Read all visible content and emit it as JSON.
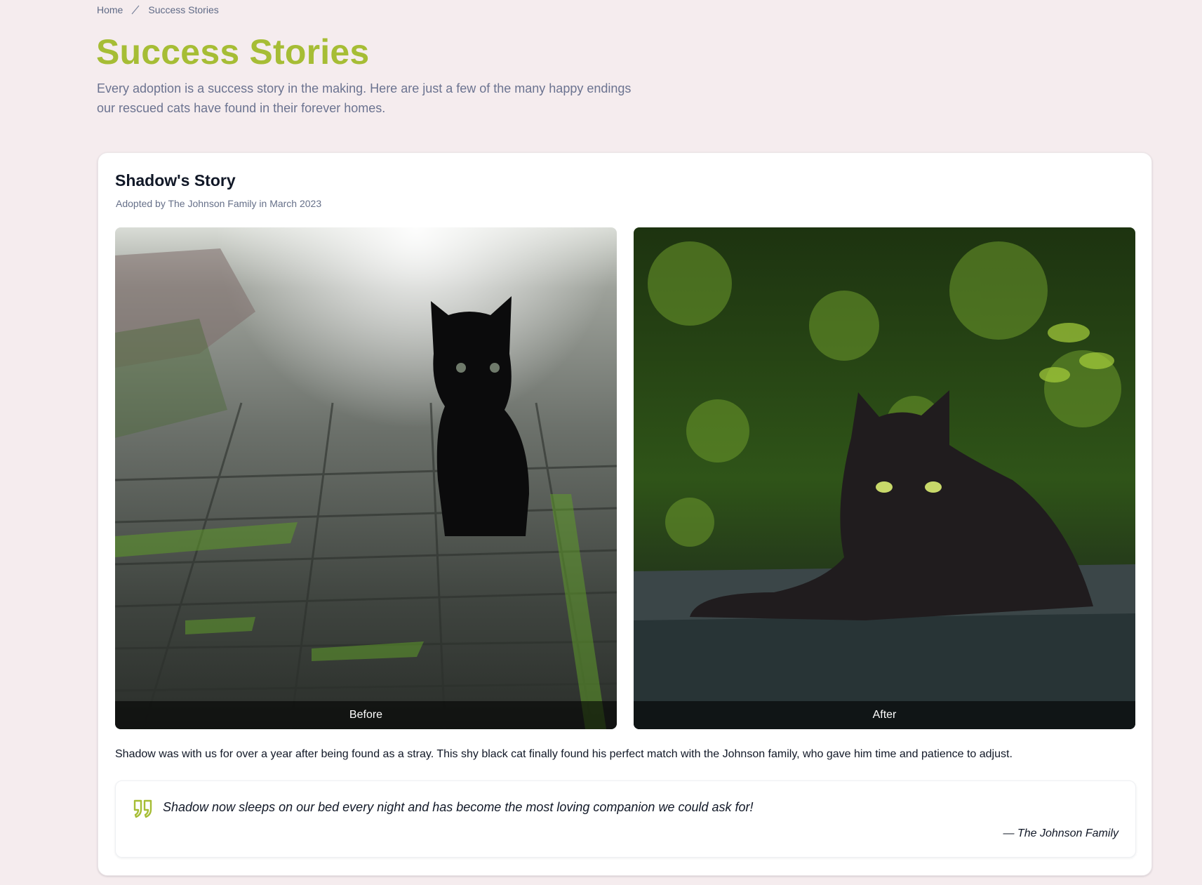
{
  "breadcrumb": {
    "home_label": "Home",
    "current_label": "Success Stories"
  },
  "header": {
    "title": "Success Stories",
    "intro": "Every adoption is a success story in the making. Here are just a few of the many happy endings our rescued cats have found in their forever homes."
  },
  "story": {
    "title": "Shadow's Story",
    "meta": "Adopted by The Johnson Family in March 2023",
    "before_label": "Before",
    "after_label": "After",
    "description": "Shadow was with us for over a year after being found as a stray. This shy black cat finally found his perfect match with the Johnson family, who gave him time and patience to adjust.",
    "quote": "Shadow now sleeps on our bed every night and has become the most loving companion we could ask for!",
    "quote_author": "— The Johnson Family"
  },
  "icons": {
    "breadcrumb_separator": "slash-icon",
    "quote": "quote-icon"
  },
  "colors": {
    "background": "#f5ecee",
    "accent": "#a6bd35",
    "muted_text": "#6b7390",
    "card": "#ffffff"
  }
}
